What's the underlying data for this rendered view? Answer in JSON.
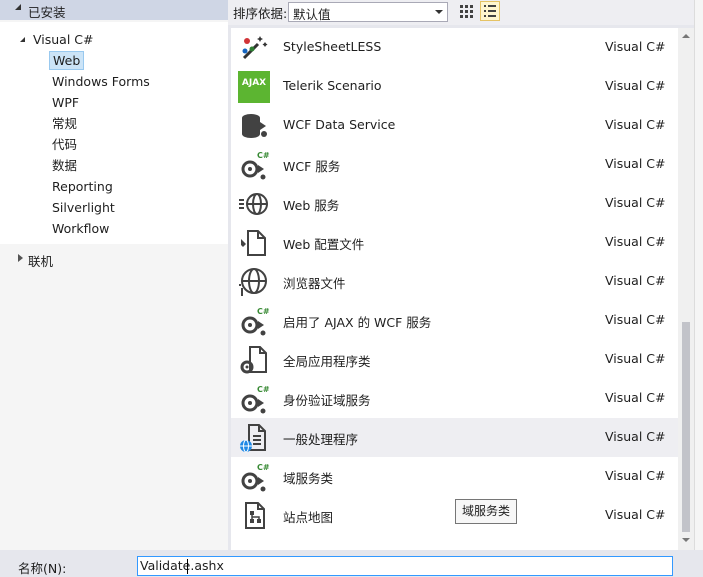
{
  "left_pane": {
    "installed_header": "已安装",
    "tree": [
      {
        "label": "Visual C#",
        "level": 0
      },
      {
        "label": "Web",
        "level": 1,
        "selected": true
      },
      {
        "label": "Windows Forms",
        "level": 1
      },
      {
        "label": "WPF",
        "level": 1
      },
      {
        "label": "常规",
        "level": 1
      },
      {
        "label": "代码",
        "level": 1
      },
      {
        "label": "数据",
        "level": 1
      },
      {
        "label": "Reporting",
        "level": 1
      },
      {
        "label": "Silverlight",
        "level": 1
      },
      {
        "label": "Workflow",
        "level": 1
      }
    ],
    "remote": "联机"
  },
  "toolbar": {
    "sort_label": "排序依据:",
    "sort_value": "默认值"
  },
  "items": [
    {
      "name": "StyleSheetLESS",
      "lang": "Visual C#",
      "icon": "stylesheet-less-icon"
    },
    {
      "name": "Telerik Scenario",
      "lang": "Visual C#",
      "icon": "ajax-icon",
      "icon_text": "AJAX"
    },
    {
      "name": "WCF Data Service",
      "lang": "Visual C#",
      "icon": "data-service-icon"
    },
    {
      "name": "WCF 服务",
      "lang": "Visual C#",
      "icon": "wcf-service-icon",
      "badge": "C#"
    },
    {
      "name": "Web 服务",
      "lang": "Visual C#",
      "icon": "web-service-icon"
    },
    {
      "name": "Web 配置文件",
      "lang": "Visual C#",
      "icon": "web-config-icon"
    },
    {
      "name": "浏览器文件",
      "lang": "Visual C#",
      "icon": "browser-file-icon"
    },
    {
      "name": "启用了 AJAX 的 WCF 服务",
      "lang": "Visual C#",
      "icon": "ajax-wcf-service-icon",
      "badge": "C#"
    },
    {
      "name": "全局应用程序类",
      "lang": "Visual C#",
      "icon": "global-app-class-icon"
    },
    {
      "name": "身份验证域服务",
      "lang": "Visual C#",
      "icon": "auth-domain-service-icon",
      "badge": "C#"
    },
    {
      "name": "一般处理程序",
      "lang": "Visual C#",
      "icon": "generic-handler-icon",
      "hovered": true
    },
    {
      "name": "域服务类",
      "lang": "Visual C#",
      "icon": "domain-service-class-icon",
      "badge": "C#"
    },
    {
      "name": "站点地图",
      "lang": "Visual C#",
      "icon": "sitemap-icon"
    }
  ],
  "tooltip": "域服务类",
  "name_field": {
    "label": "名称(N):",
    "value": "Validate.ashx"
  },
  "colors": {
    "selected_bg": "#cce4f7",
    "hover_bg": "#eeeef2",
    "ajax_green": "#5cb531",
    "badge_green": "#388a34",
    "input_border": "#3399ff"
  }
}
